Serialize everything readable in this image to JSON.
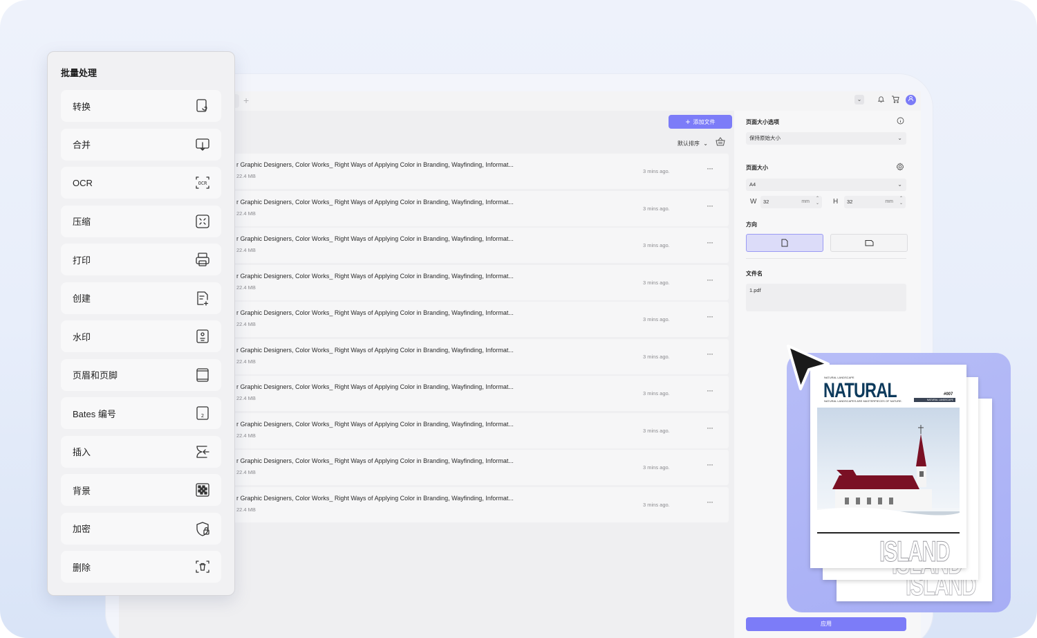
{
  "batch": {
    "title": "批量处理",
    "items": [
      {
        "label": "转换",
        "icon": "convert-icon"
      },
      {
        "label": "合并",
        "icon": "merge-icon"
      },
      {
        "label": "OCR",
        "icon": "ocr-icon"
      },
      {
        "label": "压缩",
        "icon": "compress-icon"
      },
      {
        "label": "打印",
        "icon": "printer-icon"
      },
      {
        "label": "创建",
        "icon": "create-file-icon"
      },
      {
        "label": "水印",
        "icon": "watermark-icon"
      },
      {
        "label": "页眉和页脚",
        "icon": "header-footer-icon"
      },
      {
        "label": "Bates 编号",
        "icon": "bates-number-icon"
      },
      {
        "label": "插入",
        "icon": "insert-icon"
      },
      {
        "label": "背景",
        "icon": "background-icon"
      },
      {
        "label": "加密",
        "icon": "encrypt-icon"
      },
      {
        "label": "删除",
        "icon": "delete-icon"
      }
    ]
  },
  "toolbar": {
    "add_file_label": "添加文件",
    "sort_label": "默认排序"
  },
  "files": [
    {
      "name": "r Graphic Designers, Color Works_ Right Ways of Applying Color in Branding, Wayfinding, Informat...",
      "size": "22.4 MB",
      "time": "3 mins ago."
    },
    {
      "name": "r Graphic Designers, Color Works_ Right Ways of Applying Color in Branding, Wayfinding, Informat...",
      "size": "22.4 MB",
      "time": "3 mins ago."
    },
    {
      "name": "r Graphic Designers, Color Works_ Right Ways of Applying Color in Branding, Wayfinding, Informat...",
      "size": "22.4 MB",
      "time": "3 mins ago."
    },
    {
      "name": "r Graphic Designers, Color Works_ Right Ways of Applying Color in Branding, Wayfinding, Informat...",
      "size": "22.4 MB",
      "time": "3 mins ago."
    },
    {
      "name": "r Graphic Designers, Color Works_ Right Ways of Applying Color in Branding, Wayfinding, Informat...",
      "size": "22.4 MB",
      "time": "3 mins ago."
    },
    {
      "name": "r Graphic Designers, Color Works_ Right Ways of Applying Color in Branding, Wayfinding, Informat...",
      "size": "22.4 MB",
      "time": "3 mins ago."
    },
    {
      "name": "r Graphic Designers, Color Works_ Right Ways of Applying Color in Branding, Wayfinding, Informat...",
      "size": "22.4 MB",
      "time": "3 mins ago."
    },
    {
      "name": "r Graphic Designers, Color Works_ Right Ways of Applying Color in Branding, Wayfinding, Informat...",
      "size": "22.4 MB",
      "time": "3 mins ago."
    },
    {
      "name": "r Graphic Designers, Color Works_ Right Ways of Applying Color in Branding, Wayfinding, Informat...",
      "size": "22.4 MB",
      "time": "3 mins ago."
    },
    {
      "name": "r Graphic Designers, Color Works_ Right Ways of Applying Color in Branding, Wayfinding, Informat...",
      "size": "22.4 MB",
      "time": "3 mins ago."
    }
  ],
  "panel": {
    "page_size_options_label": "页面大小选项",
    "page_size_option_value": "保持原始大小",
    "page_size_label": "页面大小",
    "page_size_value": "A4",
    "width_label": "W",
    "width_value": "32",
    "height_label": "H",
    "height_value": "32",
    "unit": "mm",
    "orientation_label": "方向",
    "filename_label": "文件名",
    "filename_value": "1.pdf",
    "apply_label": "应用"
  },
  "magazine": {
    "tag": "NATURAL LANDSCAPE",
    "title": "NATURAL",
    "subtitle": "NATURAL LANDSCAPES ARE MASTERPIECES OF NATURE.",
    "issue": "#007",
    "band": "NATURAL LANDSCAPE",
    "footer_word": "ISLAND"
  },
  "colors": {
    "accent": "#7c7cf8",
    "preview_bg": "#b0b6f6",
    "title_navy": "#0d3a5c"
  }
}
